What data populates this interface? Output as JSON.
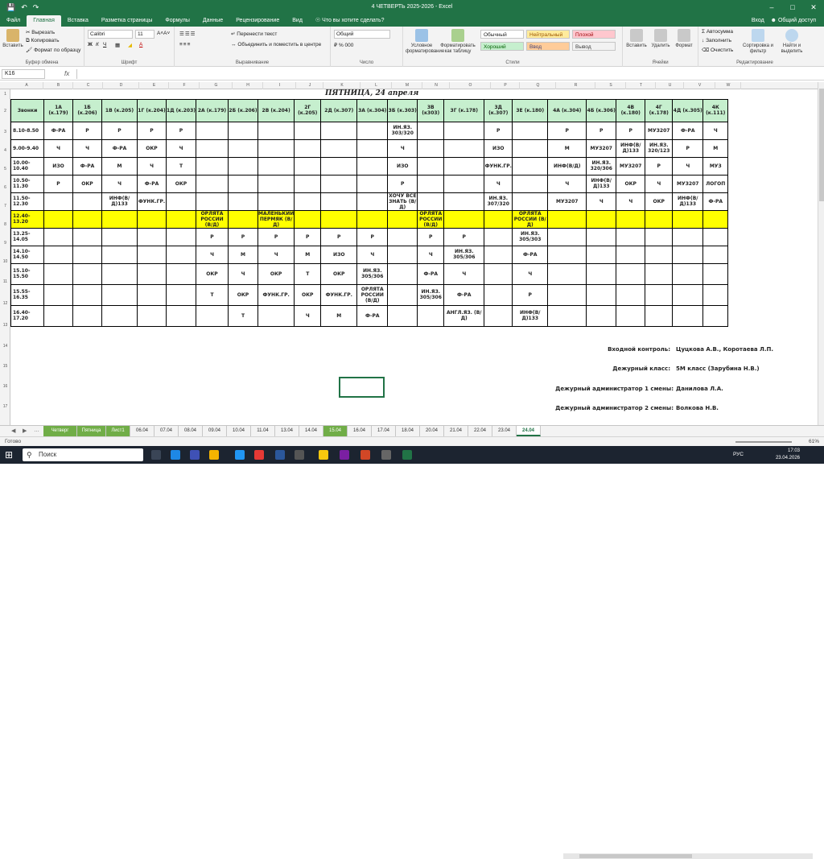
{
  "window": {
    "title": "4 ЧЕТВЕРТЬ 2025-2026 - Excel",
    "login": "Вход",
    "share": "Общий доступ"
  },
  "ribbon_tabs": [
    "Файл",
    "Главная",
    "Вставка",
    "Разметка страницы",
    "Формулы",
    "Данные",
    "Рецензирование",
    "Вид"
  ],
  "tell_me": "Что вы хотите сделать?",
  "ribbon": {
    "paste": "Вставить",
    "cut": "Вырезать",
    "copy": "Копировать",
    "format_painter": "Формат по образцу",
    "clipboard": "Буфер обмена",
    "font_name": "Calibri",
    "font_size": "11",
    "font": "Шрифт",
    "wrap": "Перенести текст",
    "merge": "Объединить и поместить в центре",
    "alignment": "Выравнивание",
    "num_format": "Общий",
    "number": "Число",
    "cond_format": "Условное форматирование",
    "as_table": "Форматировать как таблицу",
    "styles": [
      "Обычный",
      "Нейтральный",
      "Плохой",
      "Хороший",
      "Ввод",
      "Вывод"
    ],
    "styles_label": "Стили",
    "insert": "Вставить",
    "delete": "Удалить",
    "format": "Формат",
    "cells": "Ячейки",
    "autosum": "Автосумма",
    "fill": "Заполнить",
    "clear": "Очистить",
    "sort": "Сортировка и фильтр",
    "find": "Найти и выделить",
    "editing": "Редактирование"
  },
  "name_box": "K16",
  "fx": "fx",
  "columns": [
    "A",
    "B",
    "C",
    "D",
    "E",
    "F",
    "G",
    "H",
    "I",
    "J",
    "K",
    "L",
    "M",
    "N",
    "O",
    "P",
    "Q",
    "R",
    "S",
    "T",
    "U",
    "V",
    "W"
  ],
  "rows": [
    "1",
    "2",
    "3",
    "4",
    "5",
    "6",
    "7",
    "8",
    "9",
    "10",
    "11",
    "12",
    "13",
    "14",
    "15",
    "16",
    "17"
  ],
  "sheet_title": "ПЯТНИЦА, 24 апреля",
  "headers": [
    "Звонки",
    "1А (к.179)",
    "1Б (к.206)",
    "1В (к.205)",
    "1Г (к.204)",
    "1Д (к.203)",
    "2А (к.179)",
    "2Б (к.206)",
    "2В (к.204)",
    "2Г (к.205)",
    "2Д (к.307)",
    "3А (к.304)",
    "3Б (к.303)",
    "3В (к303)",
    "3Г (к.178)",
    "3Д (к.307)",
    "3Е (к.180)",
    "4А (к.304)",
    "4Б (к.306)",
    "4В (к.180)",
    "4Г (к.178)",
    "4Д (к.305)",
    "4К (к.111)"
  ],
  "schedule": [
    [
      "8.10-8.50",
      "Ф-РА",
      "Р",
      "Р",
      "Р",
      "Р",
      "",
      "",
      "",
      "",
      "",
      "",
      "ИН.ЯЗ. 303/320",
      "",
      "",
      "Р",
      "",
      "Р",
      "Р",
      "Р",
      "МУЗ207",
      "Ф-РА",
      "Ч"
    ],
    [
      "9.00-9.40",
      "Ч",
      "Ч",
      "Ф-РА",
      "ОКР",
      "Ч",
      "",
      "",
      "",
      "",
      "",
      "",
      "Ч",
      "",
      "",
      "ИЗО",
      "",
      "М",
      "МУЗ207",
      "ИНФ(В/Д)133",
      "ИН.ЯЗ. 320/123",
      "Р",
      "М"
    ],
    [
      "10.00-10.40",
      "ИЗО",
      "Ф-РА",
      "М",
      "Ч",
      "Т",
      "",
      "",
      "",
      "",
      "",
      "",
      "ИЗО",
      "",
      "",
      "ФУНК.ГР.",
      "",
      "ИНФ(В/Д)",
      "ИН.ЯЗ. 320/306",
      "МУЗ207",
      "Р",
      "Ч",
      "МУЗ"
    ],
    [
      "10.50-11.30",
      "Р",
      "ОКР",
      "Ч",
      "Ф-РА",
      "ОКР",
      "",
      "",
      "",
      "",
      "",
      "",
      "Р",
      "",
      "",
      "Ч",
      "",
      "Ч",
      "ИНФ(В/Д)133",
      "ОКР",
      "Ч",
      "МУЗ207",
      "ЛОГОП"
    ],
    [
      "11.50-12.30",
      "",
      "",
      "ИНФ(В/Д)133",
      "ФУНК.ГР.",
      "",
      "",
      "",
      "",
      "",
      "",
      "",
      "ХОЧУ ВСЕ ЗНАТЬ (В/Д)",
      "",
      "",
      "ИН.ЯЗ. 307/320",
      "",
      "МУЗ207",
      "Ч",
      "Ч",
      "ОКР",
      "ИНФ(В/Д)133",
      "Ф-РА"
    ],
    [
      "12.40-13.20",
      "",
      "",
      "",
      "",
      "",
      "ОРЛЯТА РОССИИ (В/Д)",
      "",
      "МАЛЕНЬКИЙ ПЕРМЯК (В/Д)",
      "",
      "",
      "",
      "",
      "ОРЛЯТА РОССИИ (В/Д)",
      "",
      "",
      "ОРЛЯТА РОССИИ (В/Д)",
      "",
      "",
      "",
      "",
      "",
      ""
    ],
    [
      "13.25-14.05",
      "",
      "",
      "",
      "",
      "",
      "Р",
      "Р",
      "Р",
      "Р",
      "Р",
      "Р",
      "",
      "Р",
      "Р",
      "",
      "ИН.ЯЗ. 305/303",
      "",
      "",
      "",
      "",
      "",
      ""
    ],
    [
      "14.10-14.50",
      "",
      "",
      "",
      "",
      "",
      "Ч",
      "М",
      "Ч",
      "М",
      "ИЗО",
      "Ч",
      "",
      "Ч",
      "ИН.ЯЗ. 305/306",
      "",
      "Ф-РА",
      "",
      "",
      "",
      "",
      "",
      ""
    ],
    [
      "15.10-15.50",
      "",
      "",
      "",
      "",
      "",
      "ОКР",
      "Ч",
      "ОКР",
      "Т",
      "ОКР",
      "ИН.ЯЗ. 305/306",
      "",
      "Ф-РА",
      "Ч",
      "",
      "Ч",
      "",
      "",
      "",
      "",
      "",
      ""
    ],
    [
      "15.55-16.35",
      "",
      "",
      "",
      "",
      "",
      "Т",
      "ОКР",
      "ФУНК.ГР.",
      "ОКР",
      "ФУНК.ГР.",
      "ОРЛЯТА РОССИИ (В/Д)",
      "",
      "ИН.ЯЗ. 305/306",
      "Ф-РА",
      "",
      "Р",
      "",
      "",
      "",
      "",
      "",
      ""
    ],
    [
      "16.40-17.20",
      "",
      "",
      "",
      "",
      "",
      "",
      "Т",
      "",
      "Ч",
      "М",
      "Ф-РА",
      "",
      "",
      "АНГЛ.ЯЗ. (В/Д)",
      "",
      "ИНФ(В/Д)133",
      "",
      "",
      "",
      "",
      "",
      ""
    ]
  ],
  "footer": [
    {
      "label": "Входной контроль:",
      "value": "Цуцкова А.В., Коротаева Л.П."
    },
    {
      "label": "Дежурный класс:",
      "value": "5М класс (Зарубина Н.В.)"
    },
    {
      "label": "Дежурный администратор 1 смены:",
      "value": "Данилова Л.А."
    },
    {
      "label": "Дежурный администратор 2 смены:",
      "value": "Волкова Н.В."
    }
  ],
  "sheet_tabs": [
    "Четверг",
    "Пятница",
    "Лист1",
    "06.04",
    "07.04",
    "08.04",
    "09.04",
    "10.04",
    "11.04",
    "13.04",
    "14.04",
    "15.04",
    "16.04",
    "17.04",
    "18.04",
    "20.04",
    "21.04",
    "22.04",
    "23.04",
    "24.04"
  ],
  "active_sheet": "24.04",
  "status": {
    "ready": "Готово",
    "zoom": "61%"
  },
  "taskbar": {
    "search": "Поиск",
    "lang": "РУС",
    "time": "17:03",
    "date": "23.04.2026"
  },
  "colors": {
    "excel_green": "#217346",
    "header_green": "#c6efce",
    "lunch_yellow": "#ffff00",
    "tab_green": "#70ad47"
  }
}
